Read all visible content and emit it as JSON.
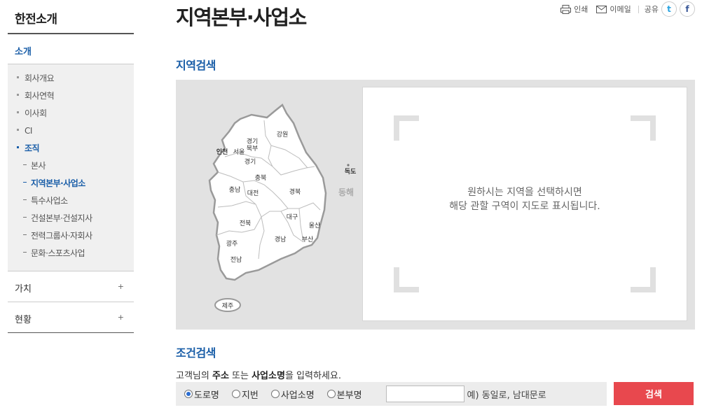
{
  "sidebar": {
    "title": "한전소개",
    "active_section": "소개",
    "items": [
      {
        "label": "회사개요"
      },
      {
        "label": "회사연혁"
      },
      {
        "label": "이사회"
      },
      {
        "label": "CI"
      },
      {
        "label": "조직"
      }
    ],
    "sub_items": [
      {
        "label": "본사"
      },
      {
        "label": "지역본부·사업소"
      },
      {
        "label": "특수사업소"
      },
      {
        "label": "건설본부·건설지사"
      },
      {
        "label": "전력그룹사·자회사"
      },
      {
        "label": "문화·스포츠사업"
      }
    ],
    "groups": [
      {
        "label": "가치",
        "toggle": "+"
      },
      {
        "label": "현황",
        "toggle": "+"
      }
    ]
  },
  "header": {
    "title": "지역본부·사업소",
    "print_label": "인쇄",
    "email_label": "이메일",
    "share_label": "공유",
    "twitter_glyph": "t",
    "facebook_glyph": "f"
  },
  "region_search": {
    "title": "지역검색",
    "message_line1": "원하시는 지역을 선택하시면",
    "message_line2": "해당 관할 구역이 지도로 표시됩니다.",
    "regions": {
      "gangwon": "강원",
      "gyeonggi_north": "경기\n북부",
      "incheon": "인천",
      "seoul": "서울",
      "gyeonggi": "경기",
      "chungbuk": "충북",
      "chungnam": "충남",
      "daejeon": "대전",
      "gyeongbuk": "경북",
      "daegu": "대구",
      "ulsan": "울산",
      "jeonbuk": "전북",
      "gyeongnam": "경남",
      "busan": "부산",
      "gwangju": "광주",
      "jeonnam": "전남",
      "jeju": "제주",
      "dokdo": "독도",
      "east_sea": "동해"
    }
  },
  "condition_search": {
    "title": "조건검색",
    "instruction_pre": "고객님의 ",
    "instruction_addr": "주소",
    "instruction_mid": " 또는 ",
    "instruction_office": "사업소명",
    "instruction_post": "을 입력하세요.",
    "options": [
      {
        "label": "도로명",
        "checked": true
      },
      {
        "label": "지번",
        "checked": false
      },
      {
        "label": "사업소명",
        "checked": false
      },
      {
        "label": "본부명",
        "checked": false
      }
    ],
    "input_value": "",
    "example": "예) 동일로, 남대문로",
    "button_label": "검색"
  },
  "colors": {
    "accent_blue": "#1a5ea8",
    "search_red": "#e8484e",
    "map_bg": "#e2e2e2"
  }
}
